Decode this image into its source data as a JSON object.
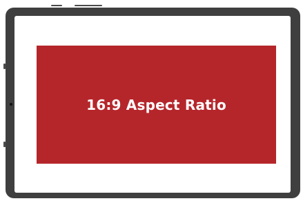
{
  "device": {
    "type": "tablet",
    "frame_color": "#3f3f3f",
    "screen_color": "#ffffff"
  },
  "content": {
    "label": "16:9 Aspect Ratio",
    "box_color": "#b5262b",
    "text_color": "#ffffff"
  }
}
